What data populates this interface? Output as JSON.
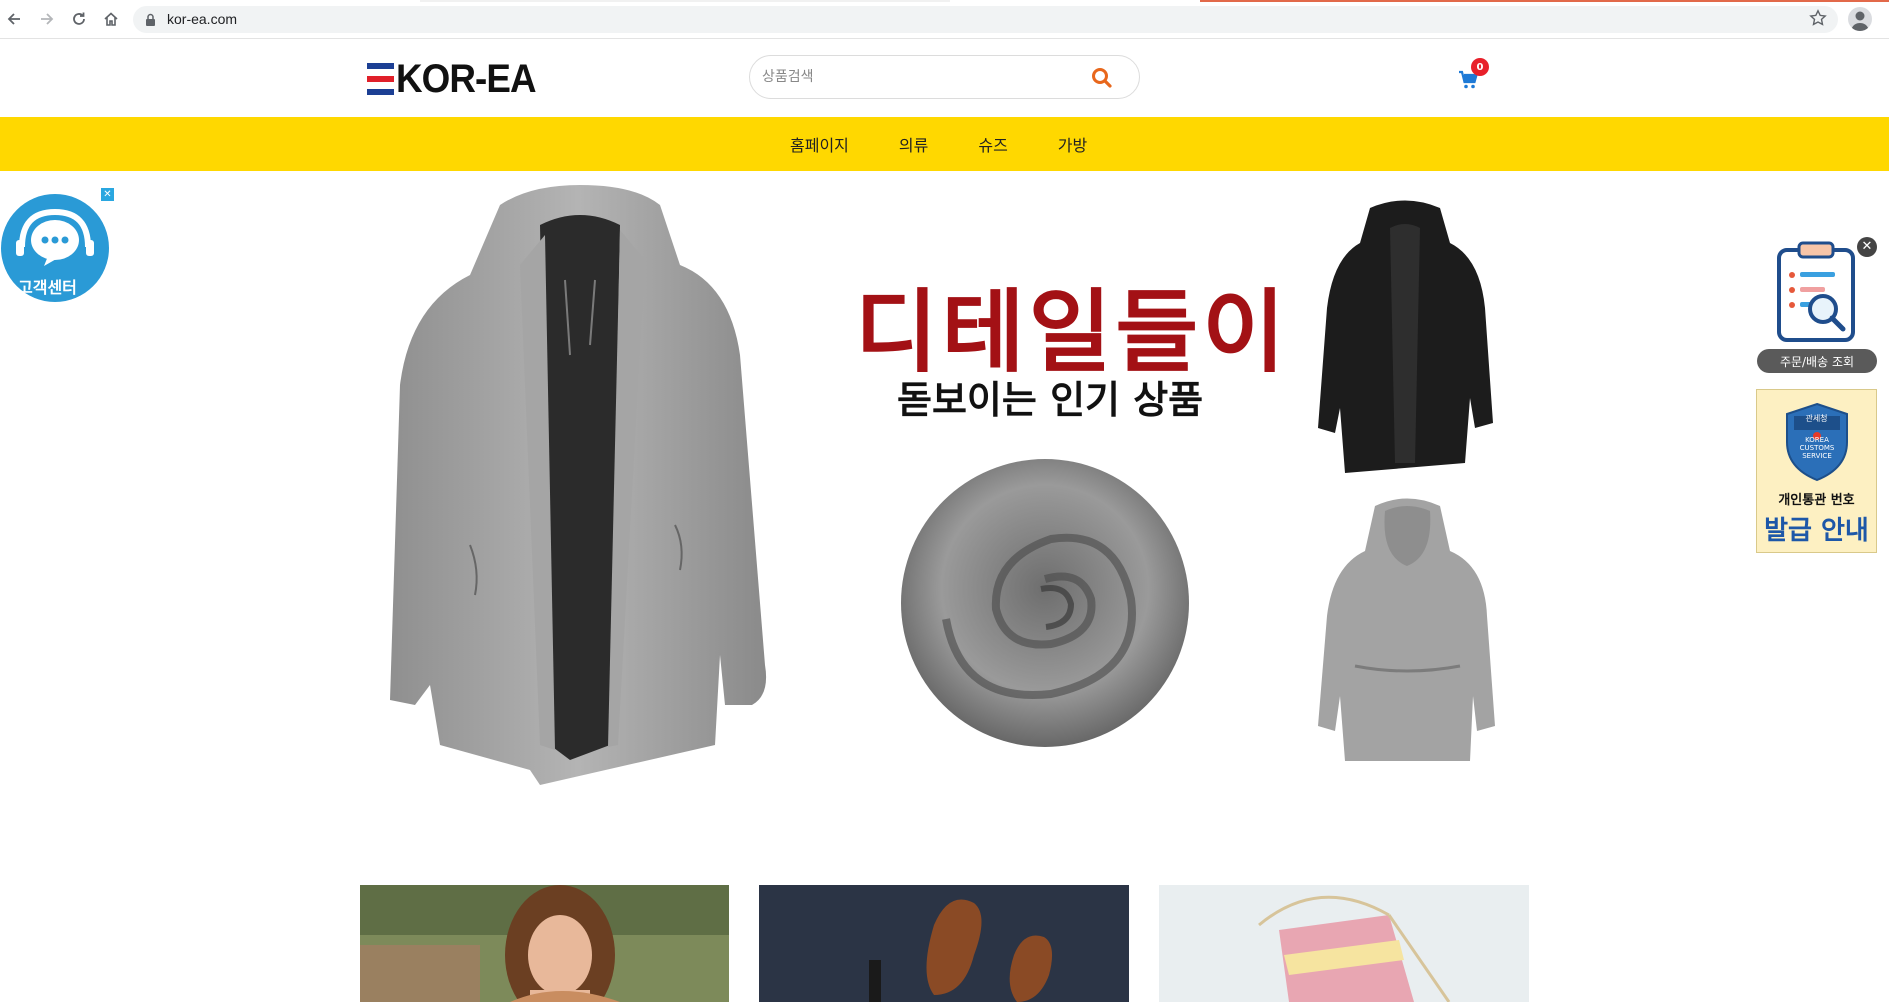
{
  "browser": {
    "url": "kor-ea.com",
    "icons": [
      "back-icon",
      "forward-icon",
      "reload-icon",
      "home-icon",
      "lock-icon",
      "star-icon",
      "profile-icon"
    ]
  },
  "header": {
    "logo_text": "KOR-EA",
    "search_placeholder": "상품검색",
    "cart_count": "0"
  },
  "nav": {
    "items": [
      {
        "label": "홈페이지"
      },
      {
        "label": "의류"
      },
      {
        "label": "슈즈"
      },
      {
        "label": "가방"
      }
    ]
  },
  "hero": {
    "title": "디테일들이",
    "subtitle": "돋보이는 인기 상품"
  },
  "widgets": {
    "customer_center": "고객센터",
    "order_lookup": "주문/배송 조회",
    "customs_seal": "관세청",
    "customs_seal_en": "KOREA CUSTOMS SERVICE",
    "customs_line1": "개인통관 번호",
    "customs_line2": "발급 안내"
  },
  "colors": {
    "accent_yellow": "#ffd800",
    "hero_red": "#a31115",
    "search_icon": "#e8671c",
    "cart_blue": "#1e7ad6",
    "badge_red": "#e8202a",
    "customs_blue": "#1d57a8"
  }
}
